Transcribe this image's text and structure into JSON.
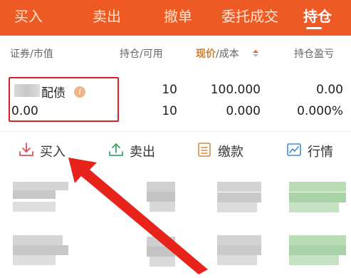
{
  "tabs": [
    {
      "label": "买入",
      "active": false
    },
    {
      "label": "卖出",
      "active": false
    },
    {
      "label": "撤单",
      "active": false
    },
    {
      "label": "委托成交",
      "active": false
    },
    {
      "label": "持仓",
      "active": true
    }
  ],
  "columns": {
    "security": "证券",
    "market_value": "/市值",
    "holding": "持仓",
    "available": "/可用",
    "price": "现价",
    "cost": "/成本",
    "pnl": "持仓盈亏"
  },
  "position": {
    "name_suffix": "配债",
    "market_value": "0.00",
    "holding": "10",
    "available": "10",
    "price": "100.000",
    "cost": "0.000",
    "pnl_amount": "0.00",
    "pnl_pct": "0.000%",
    "info_glyph": "i"
  },
  "actions": [
    {
      "label": "买入",
      "icon": "download-icon",
      "color": "#e0505a"
    },
    {
      "label": "卖出",
      "icon": "upload-icon",
      "color": "#3aa86a"
    },
    {
      "label": "缴款",
      "icon": "document-icon",
      "color": "#d98a3a"
    },
    {
      "label": "行情",
      "icon": "chart-icon",
      "color": "#3b8ed8"
    }
  ],
  "colors": {
    "accent": "#ee5a24",
    "highlight_box": "#e02020",
    "arrow": "#e8231c"
  }
}
